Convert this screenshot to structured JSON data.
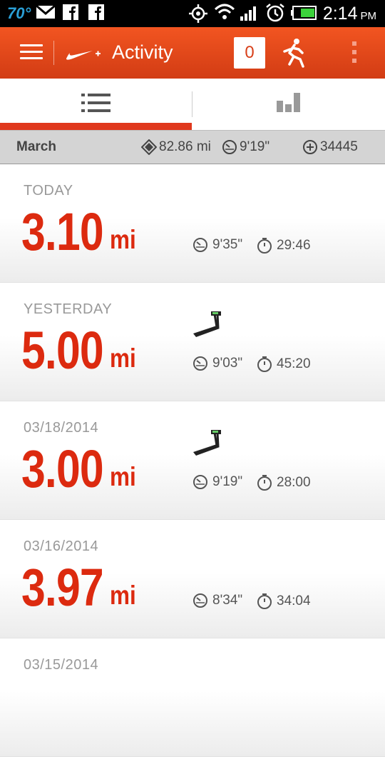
{
  "status_bar": {
    "temperature": "70°",
    "time": "2:14",
    "ampm": "PM",
    "accent": "#2a9fd6"
  },
  "app_bar": {
    "title": "Activity",
    "count": "0",
    "brand_color": "#e0381d"
  },
  "tabs": [
    {
      "name": "list",
      "icon": "list-icon",
      "selected": true
    },
    {
      "name": "chart",
      "icon": "bar-chart-icon",
      "selected": false
    }
  ],
  "summary": {
    "month": "March",
    "distance": "82.86 mi",
    "pace": "9'19\"",
    "fuel": "34445"
  },
  "runs": [
    {
      "date": "TODAY",
      "distance": "3.10",
      "unit": "mi",
      "treadmill": false,
      "pace": "9'35\"",
      "duration": "29:46"
    },
    {
      "date": "YESTERDAY",
      "distance": "5.00",
      "unit": "mi",
      "treadmill": true,
      "pace": "9'03\"",
      "duration": "45:20"
    },
    {
      "date": "03/18/2014",
      "distance": "3.00",
      "unit": "mi",
      "treadmill": true,
      "pace": "9'19\"",
      "duration": "28:00"
    },
    {
      "date": "03/16/2014",
      "distance": "3.97",
      "unit": "mi",
      "treadmill": false,
      "pace": "8'34\"",
      "duration": "34:04"
    },
    {
      "date": "03/15/2014",
      "distance": "",
      "unit": "",
      "treadmill": false,
      "pace": "",
      "duration": ""
    }
  ]
}
